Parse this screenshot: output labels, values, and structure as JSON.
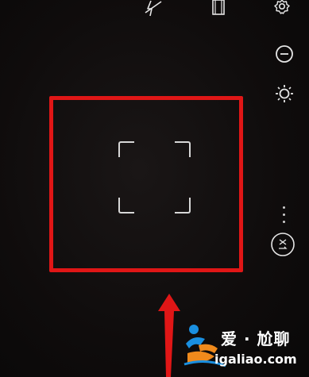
{
  "camera": {
    "top_icons": [
      "flash-off-icon",
      "film-icon",
      "settings-icon"
    ],
    "side_icons": [
      "exposure-icon",
      "brightness-icon",
      "switch-camera-icon"
    ]
  },
  "annotation": {
    "highlight_color": "#e01616",
    "arrow_color": "#e01616"
  },
  "watermark": {
    "title": "爱 · 尬聊",
    "url": "igaliao.com"
  }
}
